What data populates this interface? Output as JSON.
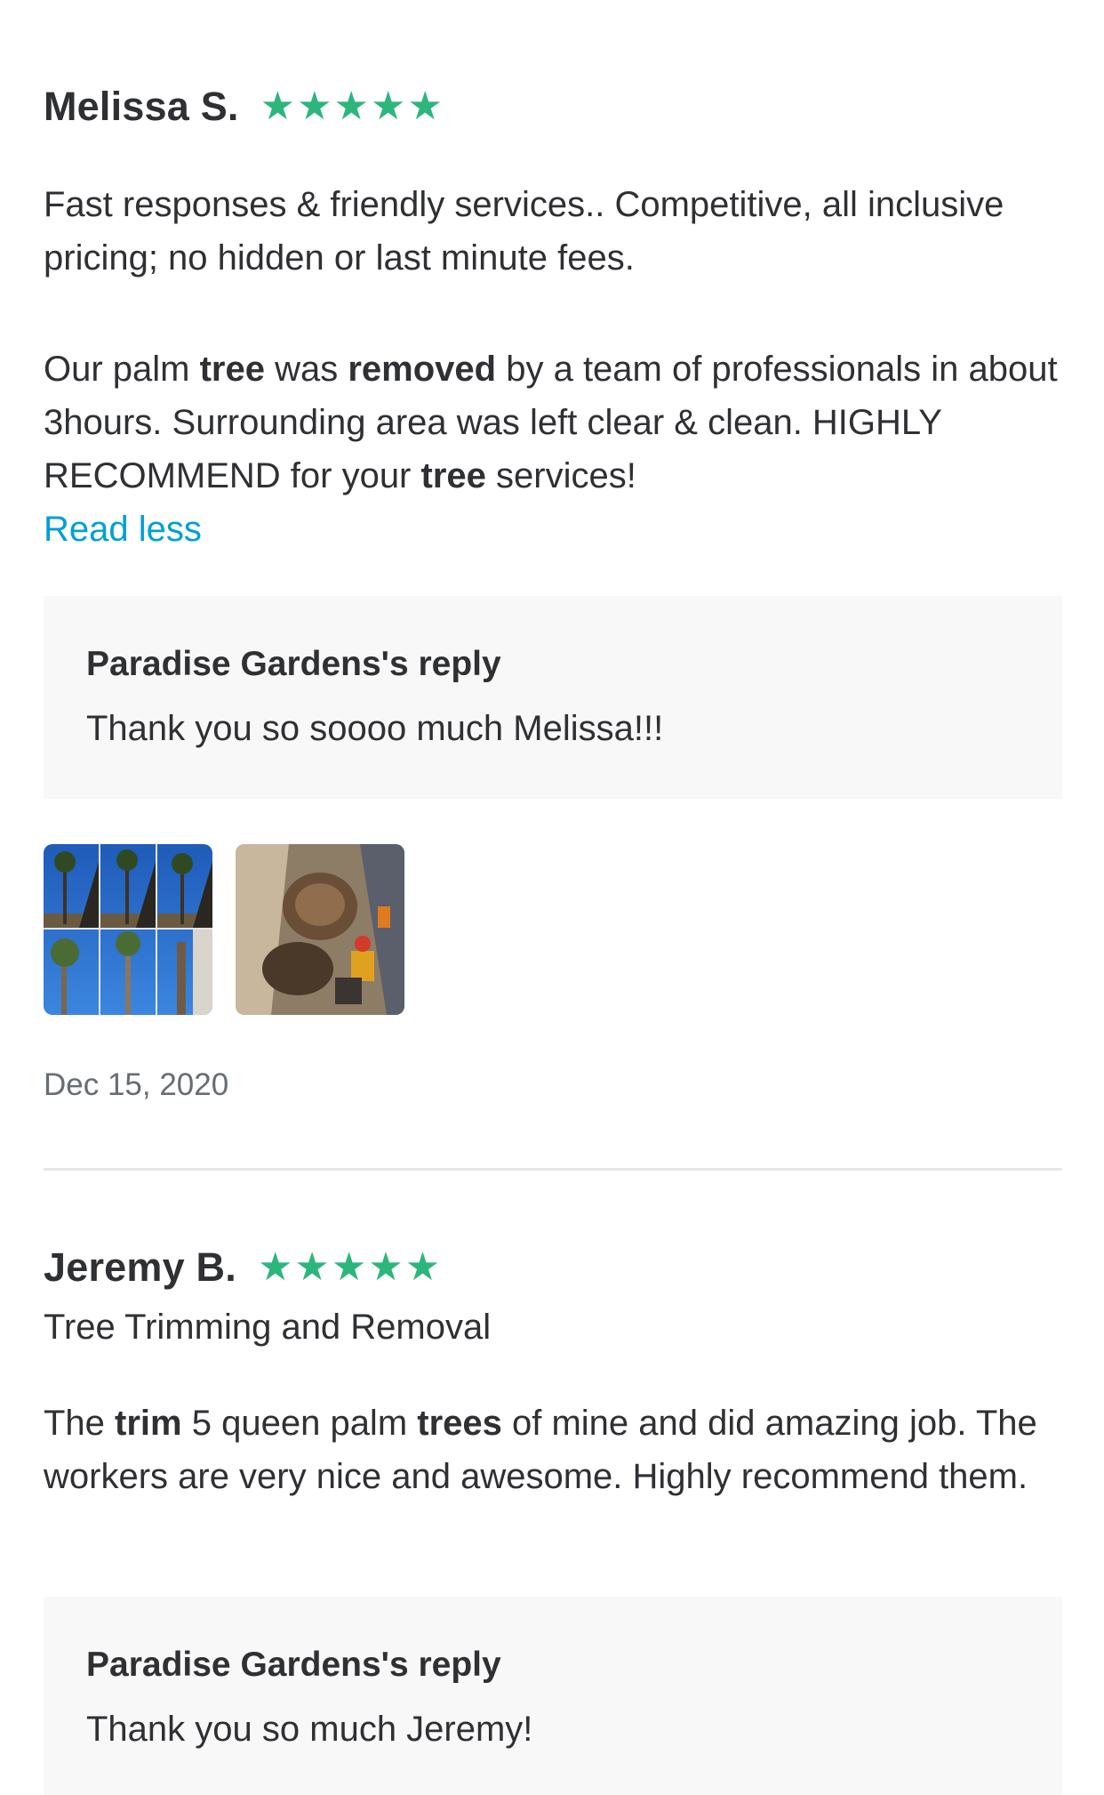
{
  "reviews": [
    {
      "name": "Melissa S.",
      "stars": 5,
      "body_p1": "Fast responses & friendly services.. Competitive, all inclusive pricing; no hidden or last minute fees.",
      "body_p2_segments": [
        {
          "text": "Our palm ",
          "bold": false
        },
        {
          "text": "tree",
          "bold": true
        },
        {
          "text": " was ",
          "bold": false
        },
        {
          "text": "removed",
          "bold": true
        },
        {
          "text": " by a team of professionals in about 3hours. Surrounding area was left clear & clean. HIGHLY RECOMMEND for your ",
          "bold": false
        },
        {
          "text": "tree",
          "bold": true
        },
        {
          "text": " services!",
          "bold": false
        }
      ],
      "read_less": "Read less",
      "reply_title": "Paradise Gardens's reply",
      "reply_text": "Thank you so soooo much Melissa!!!",
      "date": "Dec 15, 2020"
    },
    {
      "name": "Jeremy B.",
      "stars": 5,
      "service": "Tree Trimming and Removal",
      "body_segments": [
        {
          "text": "The ",
          "bold": false
        },
        {
          "text": "trim",
          "bold": true
        },
        {
          "text": " 5 queen palm ",
          "bold": false
        },
        {
          "text": "trees",
          "bold": true
        },
        {
          "text": " of mine and did amazing job. The workers are very nice and awesome. Highly recommend them.",
          "bold": false
        }
      ],
      "reply_title": "Paradise Gardens's reply",
      "reply_text": "Thank you so much Jeremy!"
    }
  ],
  "colors": {
    "star": "#2db67c",
    "link": "#009fd9",
    "text": "#2f3033",
    "muted": "#676d73",
    "reply_bg": "#f8f8f8"
  },
  "icons": {
    "star": "star-icon"
  }
}
